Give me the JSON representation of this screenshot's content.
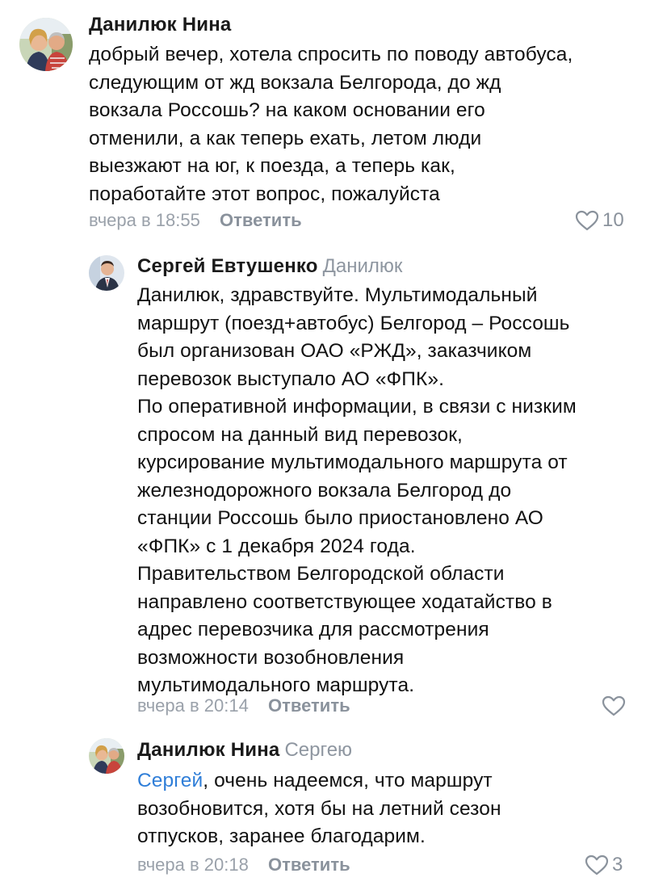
{
  "comments": [
    {
      "author": "Данилюк Нина",
      "reply_to": "",
      "mention": "",
      "text": "добрый вечер, хотела спросить по поводу автобуса,\nследующим от жд вокзала Белгорода, до жд\nвокзала Россошь? на каком основании его\nотменили, а как теперь ехать, летом люди\nвыезжают на юг, к поезда, а теперь как,\nпоработайте этот вопрос, пожалуйста",
      "time": "вчера в 18:55",
      "reply_label": "Ответить",
      "likes": "10",
      "avatar_icon": "user-photo-avatar"
    },
    {
      "author": "Сергей Евтушенко",
      "reply_to": "Данилюк",
      "mention": "",
      "text": "Данилюк, здравствуйте. Мультимодальный\nмаршрут (поезд+автобус) Белгород – Россошь\nбыл организован ОАО «РЖД», заказчиком\nперевозок выступало АО «ФПК».\nПо оперативной информации, в связи с низким\nспросом на данный вид перевозок,\nкурсирование мультимодального маршрута от\nжелезнодорожного вокзала Белгород до\nстанции Россошь было приостановлено АО\n«ФПК» с 1 декабря 2024 года.\nПравительством Белгородской области\nнаправлено соответствующее ходатайство в\nадрес перевозчика для рассмотрения\nвозможности возобновления\nмультимодального маршрута.",
      "time": "вчера в 20:14",
      "reply_label": "Ответить",
      "likes": "",
      "avatar_icon": "user-photo-avatar"
    },
    {
      "author": "Данилюк Нина",
      "reply_to": "Сергею",
      "mention": "Сергей",
      "text": ", очень надеемся, что маршрут\nвозобновится, хотя бы на летний сезон\nотпусков, заранее благодарим.",
      "time": "вчера в 20:18",
      "reply_label": "Ответить",
      "likes": "3",
      "avatar_icon": "user-photo-avatar"
    }
  ],
  "icons": {
    "like": "heart-outline-icon"
  },
  "colors": {
    "author": "#1a1a1a",
    "muted": "#9aa1aa",
    "action": "#8a929c",
    "mention": "#2f7ed8",
    "text": "#111111"
  }
}
